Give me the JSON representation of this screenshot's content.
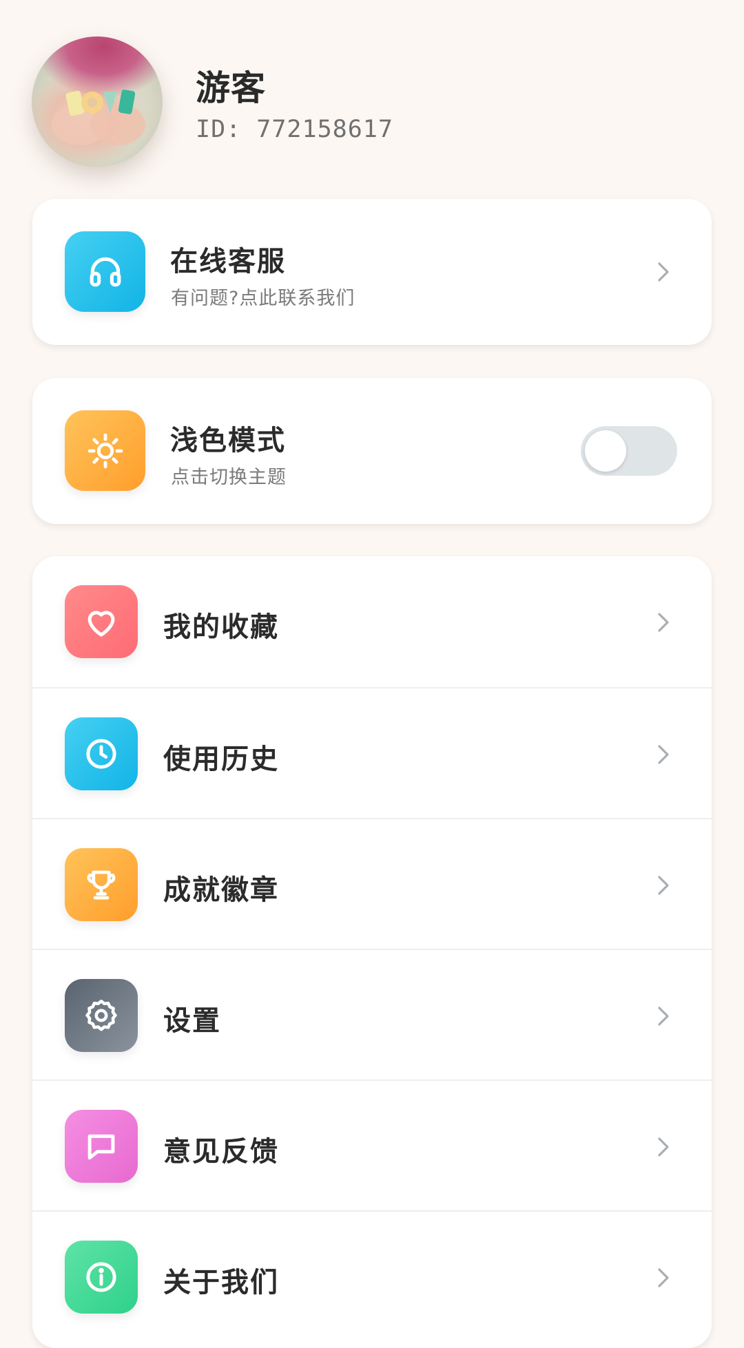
{
  "profile": {
    "name": "游客",
    "id_text": "ID: 772158617"
  },
  "service_card": {
    "title": "在线客服",
    "subtitle": "有问题?点此联系我们",
    "icon": "headphones-icon"
  },
  "theme_card": {
    "title": "浅色模式",
    "subtitle": "点击切换主题",
    "icon": "sun-icon",
    "toggle_on": false
  },
  "menu": {
    "items": [
      {
        "label": "我的收藏",
        "icon": "heart-icon",
        "color": "#ff7b7b"
      },
      {
        "label": "使用历史",
        "icon": "clock-icon",
        "color": "#2ec4ec"
      },
      {
        "label": "成就徽章",
        "icon": "trophy-icon",
        "color": "#ffaa3f"
      },
      {
        "label": "设置",
        "icon": "gear-icon",
        "color": "#6e7884"
      },
      {
        "label": "意见反馈",
        "icon": "chat-bubble-icon",
        "color": "#ee7ad8"
      },
      {
        "label": "关于我们",
        "icon": "info-icon",
        "color": "#3fdb97"
      }
    ]
  },
  "colors": {
    "background": "#fcf7f3",
    "card": "#ffffff",
    "toggle_off": "#dfe4e7",
    "chevron": "#a9aeb2"
  }
}
